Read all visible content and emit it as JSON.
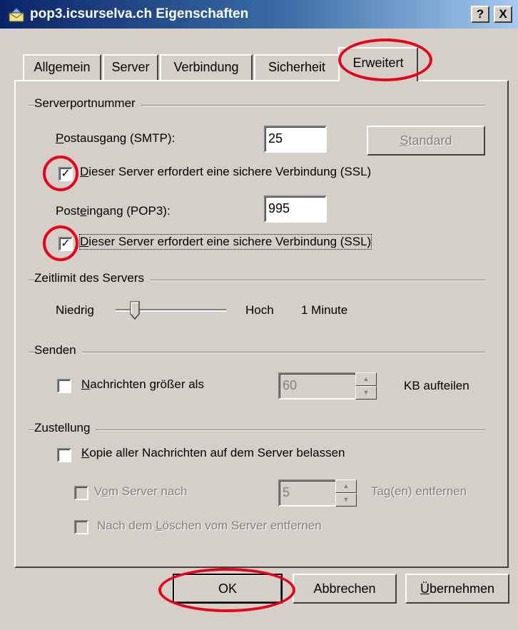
{
  "window": {
    "title": "pop3.icsurselva.ch Eigenschaften",
    "help_button": "?",
    "close_button": "X"
  },
  "tabs": [
    {
      "label": "Allgemein",
      "active": false
    },
    {
      "label": "Server",
      "active": false
    },
    {
      "label": "Verbindung",
      "active": false
    },
    {
      "label": "Sicherheit",
      "active": false
    },
    {
      "label": "Erweitert",
      "active": true
    }
  ],
  "server_ports": {
    "heading": "Serverportnummer",
    "smtp_label_u": "P",
    "smtp_label_rest": "ostausgang (SMTP):",
    "smtp_value": "25",
    "standard_button_u": "S",
    "standard_button_rest": "tandard",
    "smtp_ssl_checked": true,
    "smtp_ssl_u": "D",
    "smtp_ssl_rest": "ieser Server erfordert eine sichere Verbindung (SSL)",
    "pop3_label_a": "Post",
    "pop3_label_u": "e",
    "pop3_label_b": "ingang (POP3):",
    "pop3_value": "995",
    "pop3_ssl_checked": true,
    "pop3_ssl_u": "D",
    "pop3_ssl_rest": "ieser Server erfordert eine sichere Verbindung (SSL)"
  },
  "timeout": {
    "heading": "Zeitlimit des Servers",
    "low_label": "Niedrig",
    "high_label": "Hoch",
    "value_text": "1 Minute",
    "slider_level": 0.1
  },
  "send": {
    "heading": "Senden",
    "split_checked": false,
    "split_u": "N",
    "split_rest": "achrichten größer als",
    "split_value": "60",
    "split_unit": "KB aufteilen"
  },
  "delivery": {
    "heading": "Zustellung",
    "keep_copy_checked": false,
    "keep_copy_u": "K",
    "keep_copy_rest": "opie aller Nachrichten auf dem Server belassen",
    "remove_after_checked": false,
    "remove_after_a": "V",
    "remove_after_u": "o",
    "remove_after_b": "m Server nach",
    "remove_after_days": "5",
    "remove_after_unit": "Tag(en) entfernen",
    "remove_deleted_checked": false,
    "remove_deleted_a": "Nach dem ",
    "remove_deleted_u": "L",
    "remove_deleted_b": "öschen vom Server entfernen"
  },
  "footer": {
    "ok_label": "OK",
    "cancel_label": "Abbrechen",
    "apply_u": "Ü",
    "apply_rest": "bernehmen"
  },
  "colors": {
    "title_start": "#0a246a",
    "title_end": "#a6caf0",
    "highlight": "#e8001c",
    "face": "#d4d0c8"
  }
}
